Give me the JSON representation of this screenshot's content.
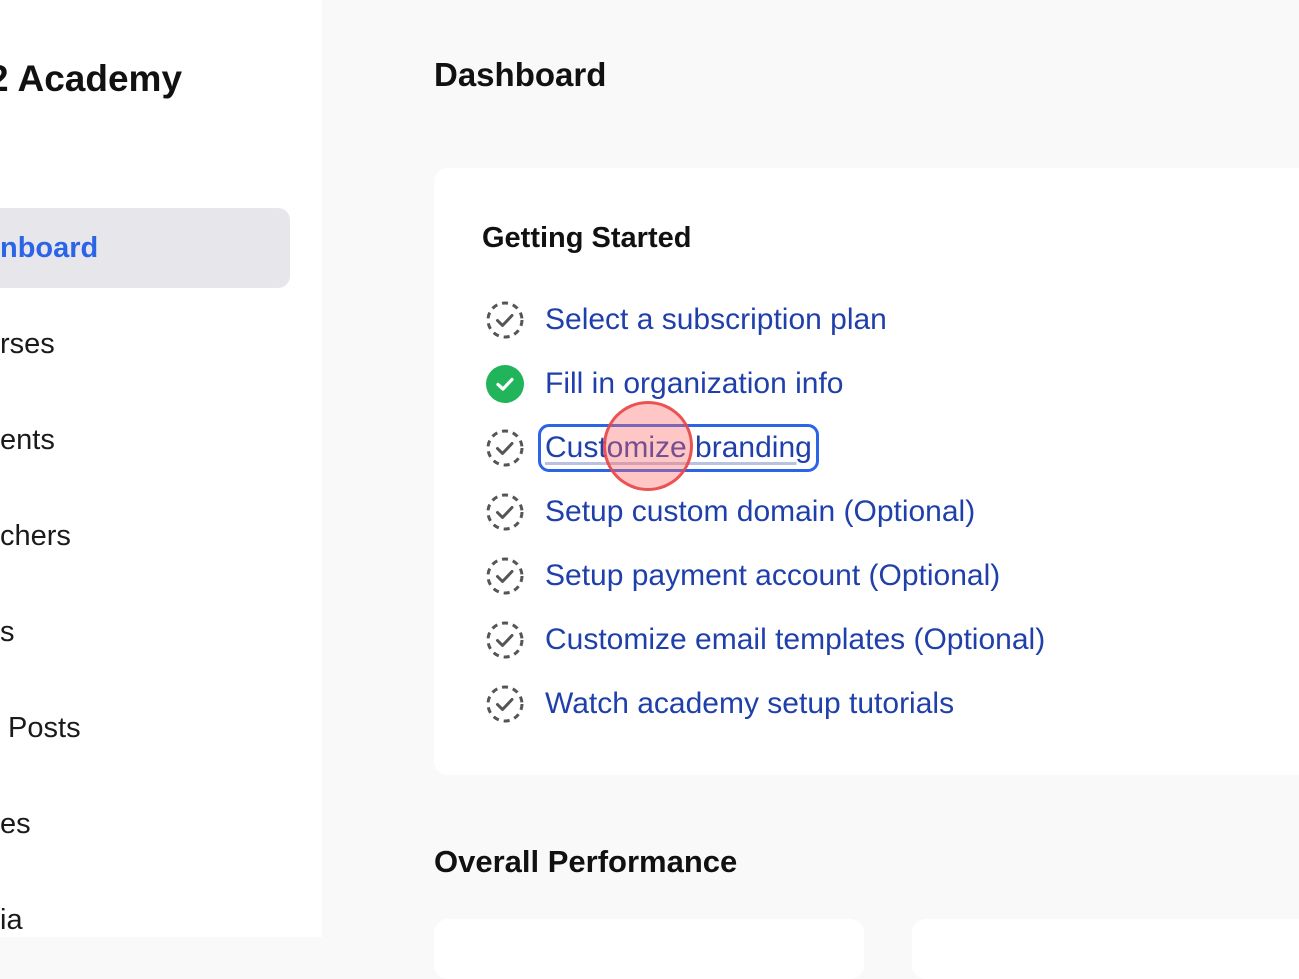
{
  "sidebar": {
    "brand": "2 Academy",
    "items": [
      {
        "label": "nboard",
        "active": true
      },
      {
        "label": "rses",
        "active": false
      },
      {
        "label": "ents",
        "active": false
      },
      {
        "label": "chers",
        "active": false
      },
      {
        "label": "s",
        "active": false
      },
      {
        "label": " Posts",
        "active": false
      },
      {
        "label": "es",
        "active": false
      },
      {
        "label": "ia",
        "active": false
      }
    ]
  },
  "main": {
    "page_title": "Dashboard",
    "getting_started": {
      "title": "Getting Started",
      "steps": [
        {
          "label": "Select a subscription plan",
          "status": "pending"
        },
        {
          "label": "Fill in organization info",
          "status": "done"
        },
        {
          "label": "Customize branding",
          "status": "pending"
        },
        {
          "label": "Setup custom domain (Optional)",
          "status": "pending"
        },
        {
          "label": "Setup payment account (Optional)",
          "status": "pending"
        },
        {
          "label": "Customize email templates (Optional)",
          "status": "pending"
        },
        {
          "label": "Watch academy setup tutorials",
          "status": "pending"
        }
      ]
    },
    "performance": {
      "title": "Overall Performance"
    }
  },
  "colors": {
    "accent": "#2c64e8",
    "link": "#1f3faa",
    "success": "#22b45a",
    "pending_icon": "#555555"
  },
  "icons": {
    "pending": "dashed-circle-check-icon",
    "done": "filled-circle-check-icon"
  }
}
